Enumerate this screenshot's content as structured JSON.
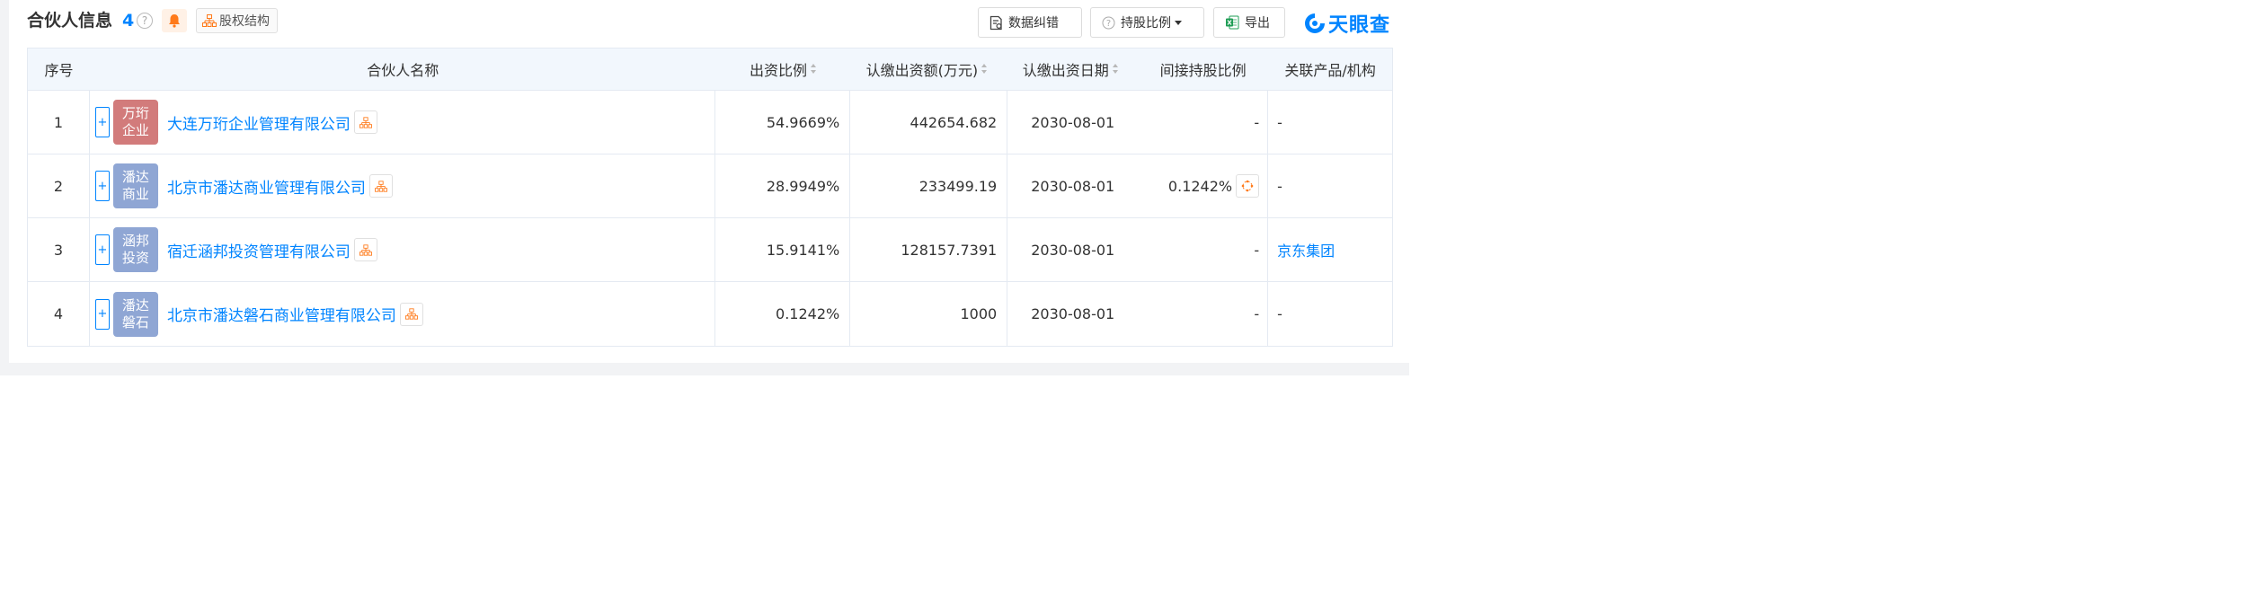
{
  "header": {
    "title": "合伙人信息",
    "count": "4",
    "help_glyph": "?",
    "equity_label": "股权结构",
    "data_correction_label": "数据纠错",
    "holding_ratio_label": "持股比例",
    "export_label": "导出",
    "logo_text": "天眼查"
  },
  "colors": {
    "accent": "#0084ff",
    "orange": "#ff7a1a",
    "avatar_red": "#d27b7b",
    "avatar_blue": "#8fa6d4"
  },
  "table": {
    "columns": [
      "序号",
      "合伙人名称",
      "出资比例",
      "认缴出资额(万元)",
      "认缴出资日期",
      "间接持股比例",
      "关联产品/机构"
    ],
    "rows": [
      {
        "index": "1",
        "avatar_line1": "万珩",
        "avatar_line2": "企业",
        "avatar_color": "#d27b7b",
        "name": "大连万珩企业管理有限公司",
        "ratio": "54.9669%",
        "amount": "442654.682",
        "date": "2030-08-01",
        "indirect": "-",
        "related": "-"
      },
      {
        "index": "2",
        "avatar_line1": "潘达",
        "avatar_line2": "商业",
        "avatar_color": "#8fa6d4",
        "name": "北京市潘达商业管理有限公司",
        "ratio": "28.9949%",
        "amount": "233499.19",
        "date": "2030-08-01",
        "indirect": "0.1242%",
        "related": "-"
      },
      {
        "index": "3",
        "avatar_line1": "涵邦",
        "avatar_line2": "投资",
        "avatar_color": "#8fa6d4",
        "name": "宿迁涵邦投资管理有限公司",
        "ratio": "15.9141%",
        "amount": "128157.7391",
        "date": "2030-08-01",
        "indirect": "-",
        "related": "京东集团"
      },
      {
        "index": "4",
        "avatar_line1": "潘达",
        "avatar_line2": "磐石",
        "avatar_color": "#8fa6d4",
        "name": "北京市潘达磐石商业管理有限公司",
        "ratio": "0.1242%",
        "amount": "1000",
        "date": "2030-08-01",
        "indirect": "-",
        "related": "-"
      }
    ]
  },
  "expand_glyph": "+"
}
